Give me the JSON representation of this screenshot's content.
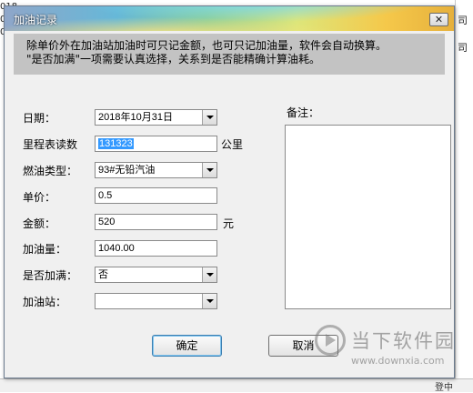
{
  "background": {
    "cells": [
      "018",
      "018",
      "018",
      "018"
    ],
    "right_cells": [
      "司"
    ],
    "status_label": "登中"
  },
  "dialog": {
    "title": "加油记录",
    "close_glyph": "✕",
    "notice": [
      "除单价外在加油站加油时可只记金额，也可只记加油量，软件会自动换算。",
      "\"是否加满\"一项需要认真选择，关系到是否能精确计算油耗。"
    ],
    "fields": {
      "date": {
        "label": "日期：",
        "value": "2018年10月31日"
      },
      "odometer": {
        "label": "里程表读数",
        "value": "131323",
        "unit": "公里"
      },
      "fuel_type": {
        "label": "燃油类型：",
        "value": "93#无铅汽油"
      },
      "unit_price": {
        "label": "单价：",
        "value": "0.5"
      },
      "amount": {
        "label": "金额：",
        "value": "520",
        "unit": "元"
      },
      "volume": {
        "label": "加油量：",
        "value": "1040.00"
      },
      "full_tank": {
        "label": "是否加满：",
        "value": "否"
      },
      "station": {
        "label": "加油站：",
        "value": ""
      }
    },
    "notes_label": "备注：",
    "notes_value": "",
    "ok_label": "确定",
    "cancel_label": "取消"
  },
  "watermark": {
    "text": "当下软件园",
    "url": "www.downxia.com"
  }
}
